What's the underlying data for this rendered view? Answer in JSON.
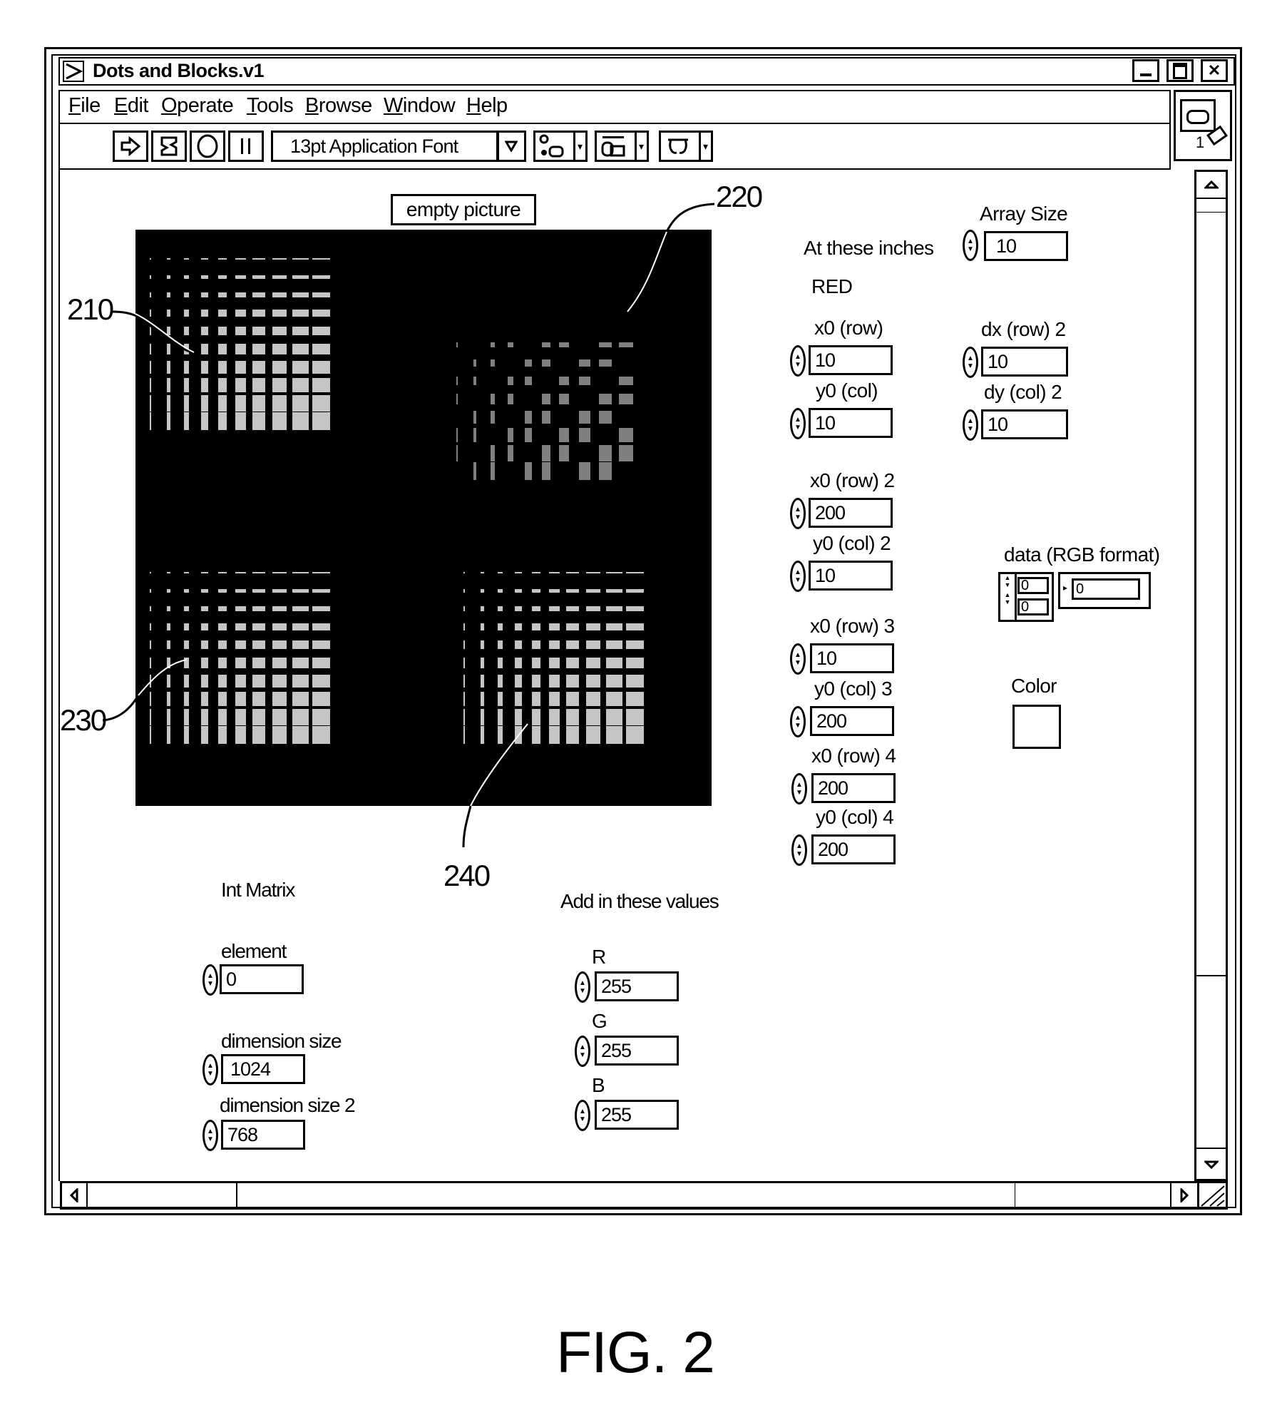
{
  "window": {
    "title": "Dots and Blocks.v1",
    "icon": "run-arrow-icon",
    "controls": [
      "minimize",
      "restore",
      "close"
    ]
  },
  "menu": {
    "items": [
      {
        "label": "File",
        "mnemonic": "F"
      },
      {
        "label": "Edit",
        "mnemonic": "E"
      },
      {
        "label": "Operate",
        "mnemonic": "O"
      },
      {
        "label": "Tools",
        "mnemonic": "T"
      },
      {
        "label": "Browse",
        "mnemonic": "B"
      },
      {
        "label": "Window",
        "mnemonic": "W"
      },
      {
        "label": "Help",
        "mnemonic": "H"
      }
    ]
  },
  "toolbar": {
    "buttons": [
      "run-icon",
      "run-continuously-icon",
      "abort-icon",
      "pause-icon"
    ],
    "font_select": "13pt Application Font",
    "dropdowns": [
      "align-objects-icon",
      "distribute-objects-icon",
      "reorder-icon"
    ]
  },
  "picture": {
    "label": "empty picture",
    "background": "#000000",
    "blocks": [
      {
        "id": "210",
        "grid": 10,
        "quadrant": "top-left"
      },
      {
        "id": "220",
        "grid": 10,
        "quadrant": "top-right"
      },
      {
        "id": "230",
        "grid": 10,
        "quadrant": "bottom-left"
      },
      {
        "id": "240",
        "grid": 10,
        "quadrant": "bottom-right"
      }
    ]
  },
  "callouts": [
    "210",
    "220",
    "230",
    "240"
  ],
  "controls": {
    "at_these_inches": "At these inches",
    "red_label": "RED",
    "array_size": {
      "label": "Array Size",
      "value": "10"
    },
    "x0_row": {
      "label": "x0 (row)",
      "value": "10"
    },
    "y0_col": {
      "label": "y0 (col)",
      "value": "10"
    },
    "dx_row_2": {
      "label": "dx (row) 2",
      "value": "10"
    },
    "dy_col_2": {
      "label": "dy (col) 2",
      "value": "10"
    },
    "x0_row_2": {
      "label": "x0 (row) 2",
      "value": "200"
    },
    "y0_col_2": {
      "label": "y0 (col) 2",
      "value": "10"
    },
    "x0_row_3": {
      "label": "x0 (row) 3",
      "value": "10"
    },
    "y0_col_3": {
      "label": "y0 (col) 3",
      "value": "200"
    },
    "x0_row_4": {
      "label": "x0 (row) 4",
      "value": "200"
    },
    "y0_col_4": {
      "label": "y0 (col) 4",
      "value": "200"
    },
    "data_rgb": {
      "label": "data (RGB format)",
      "index0": "0",
      "index1": "0",
      "value": "0"
    },
    "color": {
      "label": "Color",
      "value": "#ffffff"
    },
    "int_matrix": "Int Matrix",
    "element": {
      "label": "element",
      "value": "0"
    },
    "dimension_size": {
      "label": "dimension size",
      "value": "1024"
    },
    "dimension_size_2": {
      "label": "dimension size 2",
      "value": "768"
    },
    "add_values": "Add in these values",
    "r": {
      "label": "R",
      "value": "255"
    },
    "g": {
      "label": "G",
      "value": "255"
    },
    "b": {
      "label": "B",
      "value": "255"
    }
  },
  "caption": "FIG. 2"
}
